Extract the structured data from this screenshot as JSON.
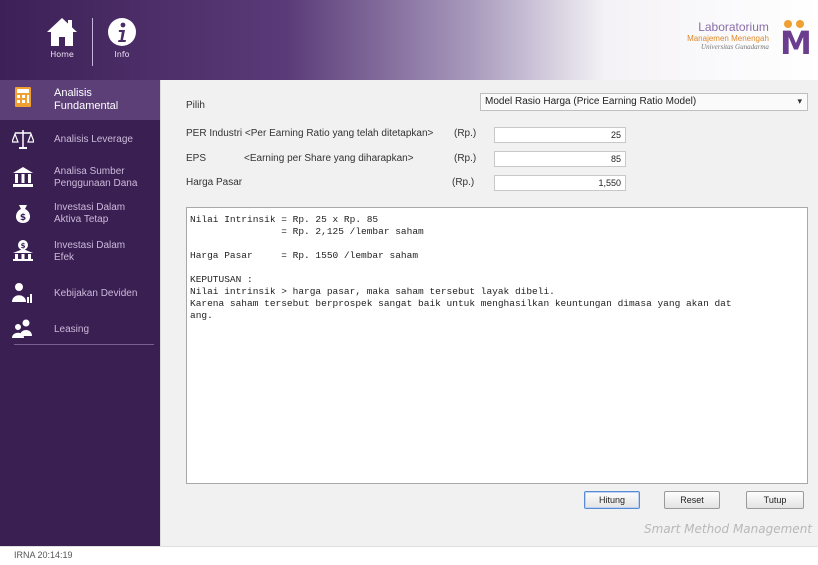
{
  "header": {
    "home_label": "Home",
    "info_label": "Info",
    "logo_line1": "Laboratorium",
    "logo_line2": "Manajemen Menengah",
    "logo_line3": "Universitas Gunadarma",
    "logo_letter": "M"
  },
  "sidebar": {
    "items": [
      {
        "label": "Analisis Fundamental",
        "icon": "calculator-icon",
        "active": true
      },
      {
        "label": "Analisis Leverage",
        "icon": "scale-icon"
      },
      {
        "label": "Analisa Sumber Penggunaan Dana",
        "icon": "bank-icon"
      },
      {
        "label": "Investasi Dalam Aktiva Tetap",
        "icon": "money-bag-icon"
      },
      {
        "label": "Investasi Dalam Efek",
        "icon": "bank-money-icon"
      },
      {
        "label": "Kebijakan Deviden",
        "icon": "person-chart-icon"
      },
      {
        "label": "Leasing",
        "icon": "people-icon"
      }
    ]
  },
  "form": {
    "pilih_label": "Pilih",
    "model_value": "Model Rasio Harga (Price Earning Ratio Model)",
    "per_label": "PER Industri <Per Earning Ratio yang telah ditetapkan>",
    "per_unit": "(Rp.)",
    "per_value": "25",
    "eps_label": "EPS",
    "eps_desc": "<Earning per Share yang diharapkan>",
    "eps_unit": "(Rp.)",
    "eps_value": "85",
    "harga_label": "Harga Pasar",
    "harga_unit": "(Rp.)",
    "harga_value": "1,550"
  },
  "result": {
    "lines": [
      "Nilai Intrinsik = Rp. 25 x Rp. 85",
      "                = Rp. 2,125 /lembar saham",
      "",
      "Harga Pasar     = Rp. 1550 /lembar saham",
      "",
      "KEPUTUSAN :",
      "Nilai intrinsik > harga pasar, maka saham tersebut layak dibeli.",
      "Karena saham tersebut berprospek sangat baik untuk menghasilkan keuntungan dimasa yang akan dat",
      "ang."
    ]
  },
  "buttons": {
    "hitung": "Hitung",
    "reset": "Reset",
    "tutup": "Tutup"
  },
  "brand": "Smart Method Management",
  "status": "IRNA  20:14:19",
  "colors": {
    "sidebar_bg": "#3a1f52",
    "sidebar_active": "#5d3f78",
    "header_purple": "#3d2056",
    "logo_orange": "#e08a2a"
  }
}
